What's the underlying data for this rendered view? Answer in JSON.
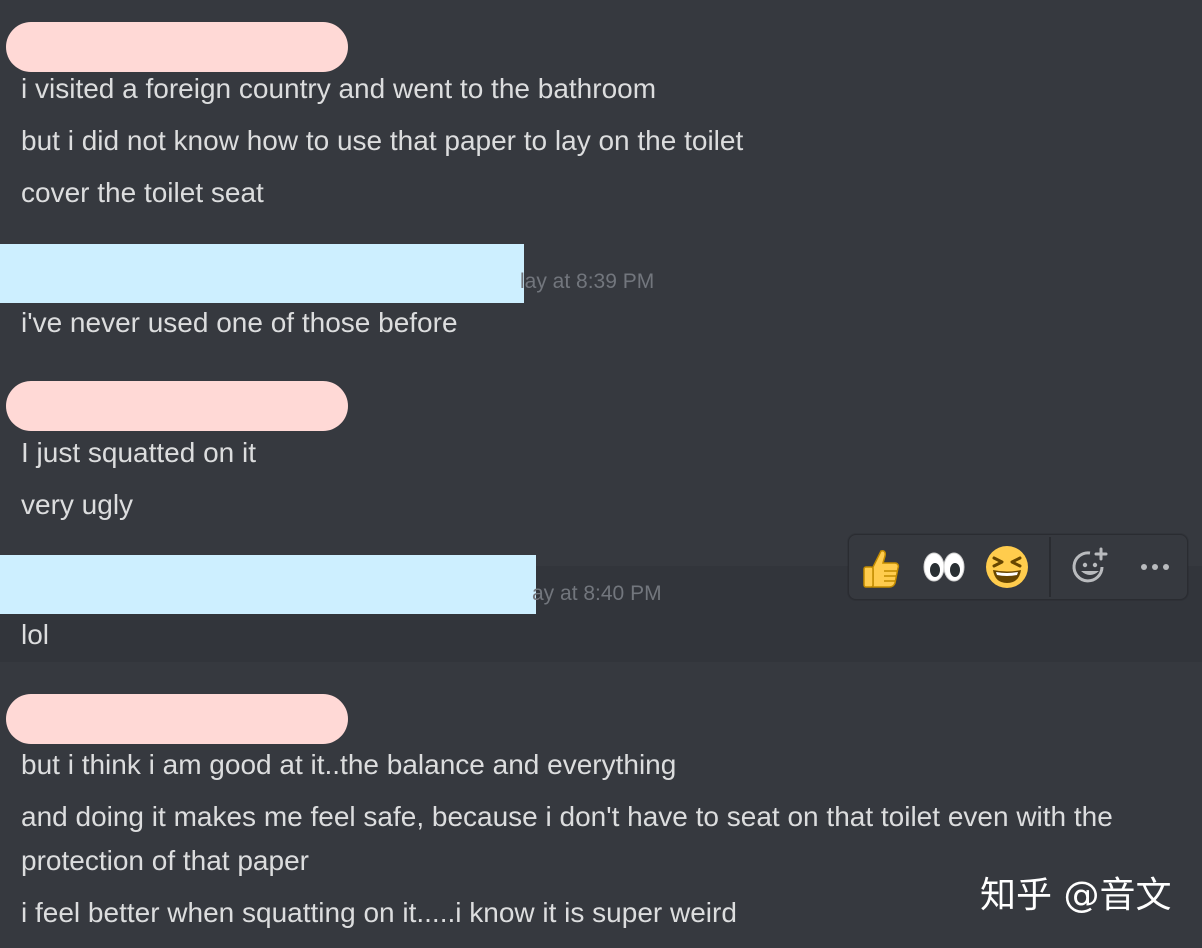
{
  "messages": [
    {
      "lines": [
        "i visited a foreign  country and went to the bathroom",
        "but i did not know how to use that paper to lay on the toilet",
        "cover the toilet seat"
      ]
    },
    {
      "timestamp": "lay at 8:39 PM",
      "lines": [
        "i've never used one of those before"
      ]
    },
    {
      "lines": [
        "I just squatted on it",
        "very ugly"
      ]
    },
    {
      "timestamp": "ay at 8:40 PM",
      "lines": [
        "lol"
      ]
    },
    {
      "lines": [
        "but i think i am good at it..the balance and everything",
        "and doing it makes me feel safe, because i don't have to seat on that toilet even with the protection of that paper",
        "i feel better when squatting on it.....i know it is super weird"
      ]
    }
  ],
  "reaction_bar": {
    "icons": [
      "thumbs-up-icon",
      "eyes-icon",
      "laughing-face-icon",
      "add-reaction-icon",
      "more-options-icon"
    ],
    "more_label": "···"
  },
  "watermark": "知乎 @音文",
  "colors": {
    "background": "#36393f",
    "text": "#dcddde",
    "timestamp": "#72767d",
    "redaction_pink": "#ffd9d6",
    "redaction_blue": "#cdefff"
  }
}
